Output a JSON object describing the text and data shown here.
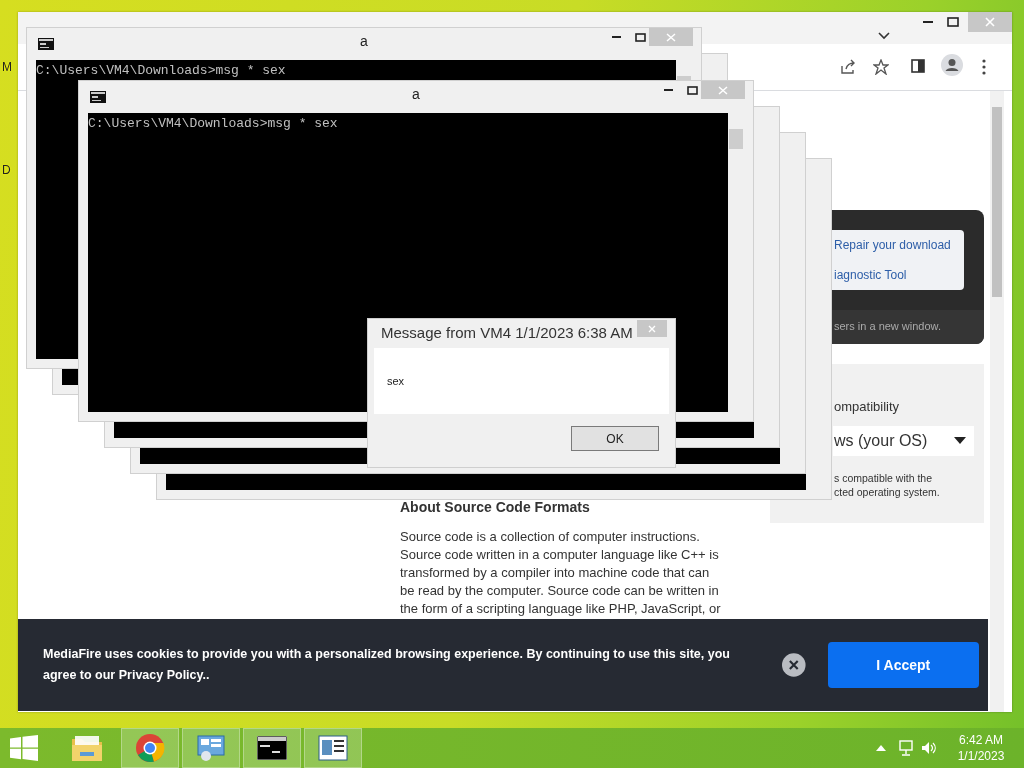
{
  "desktop": {
    "icon_labels": [
      "M",
      "D"
    ]
  },
  "browser": {
    "download_panel": {
      "links": [
        "Repair your download",
        "iagnostic Tool"
      ],
      "note": "sers in a new window."
    },
    "compatibility": {
      "label": "ompatibility",
      "select_value": "ws (your OS)",
      "note_lines": [
        "s compatible with the",
        "cted operating system."
      ]
    },
    "article": {
      "heading": "About Source Code Formats",
      "body": "Source code is a collection of computer instructions. Source code written in a computer language like C++ is transformed by a compiler into machine code that can be read by the computer. Source code can be written in the form of a scripting language like PHP, JavaScript, or"
    },
    "cookie_banner": {
      "text": "MediaFire uses cookies to provide you with a personalized browsing experience. By continuing to use this site, you agree to our Privacy Policy..",
      "button": "I Accept"
    }
  },
  "console_windows": [
    {
      "title": "a",
      "lines": [
        "C:\\Users\\VM4\\Downloads>msg * sex"
      ]
    },
    {
      "title": "a",
      "lines": [
        "C:\\Users\\VM4\\Downloads>msg * sex"
      ]
    }
  ],
  "message_box": {
    "title": "Message from VM4 1/1/2023 6:38 AM",
    "message": "sex",
    "button": "OK"
  },
  "taskbar": {
    "apps": [
      {
        "kind": "explorer",
        "running": false
      },
      {
        "kind": "chrome",
        "running": true
      },
      {
        "kind": "control",
        "running": true
      },
      {
        "kind": "console",
        "running": true
      },
      {
        "kind": "reader",
        "running": true
      }
    ],
    "clock": {
      "time": "6:42 AM",
      "date": "1/1/2023"
    }
  }
}
